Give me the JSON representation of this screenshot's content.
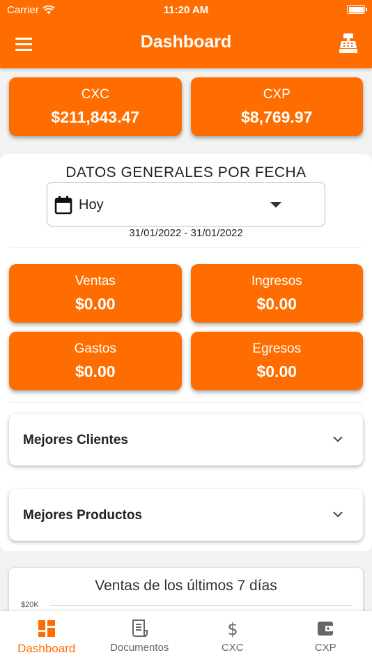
{
  "colors": {
    "accent": "#ff6d00",
    "background": "#f2f2f2",
    "text": "#222222"
  },
  "status_bar": {
    "carrier": "Carrier",
    "time": "11:20 AM"
  },
  "app_bar": {
    "title": "Dashboard",
    "menu_icon": "hamburger-menu-icon",
    "action_icon": "cash-register-icon"
  },
  "summary": [
    {
      "label": "CXC",
      "value": "$211,843.47"
    },
    {
      "label": "CXP",
      "value": "$8,769.97"
    }
  ],
  "filter": {
    "heading": "DATOS GENERALES POR FECHA",
    "selected": "Hoy",
    "icon": "calendar-icon",
    "date_range": "31/01/2022 - 31/01/2022"
  },
  "stats": [
    {
      "label": "Ventas",
      "value": "$0.00"
    },
    {
      "label": "Ingresos",
      "value": "$0.00"
    },
    {
      "label": "Gastos",
      "value": "$0.00"
    },
    {
      "label": "Egresos",
      "value": "$0.00"
    }
  ],
  "sections": [
    {
      "title": "Mejores Clientes"
    },
    {
      "title": "Mejores Productos"
    }
  ],
  "chart": {
    "title": "Ventas de los últimos 7 días",
    "y_tick": "$20K"
  },
  "chart_data": {
    "type": "bar",
    "title": "Ventas de los últimos 7 días",
    "y_ticks": [
      "$20K"
    ],
    "categories": [],
    "values": []
  },
  "bottom_nav": [
    {
      "label": "Dashboard",
      "icon": "dashboard-icon",
      "active": true
    },
    {
      "label": "Documentos",
      "icon": "receipt-icon",
      "active": false
    },
    {
      "label": "CXC",
      "icon": "dollar-icon",
      "active": false
    },
    {
      "label": "CXP",
      "icon": "wallet-icon",
      "active": false
    }
  ]
}
